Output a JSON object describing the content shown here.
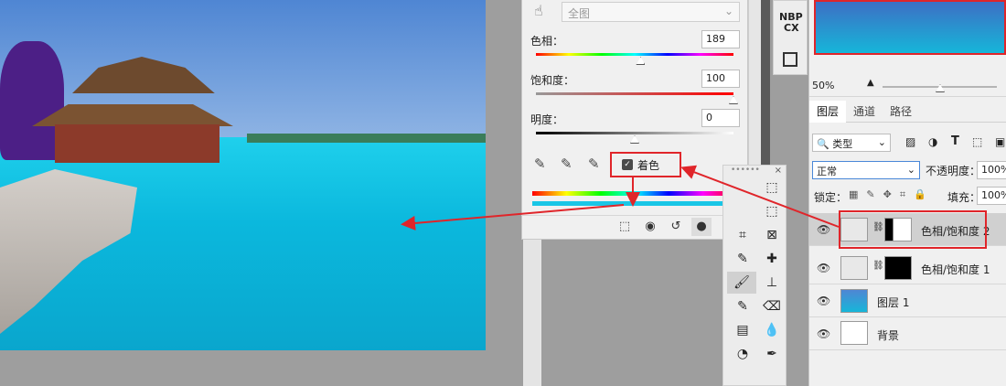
{
  "canvas": {
    "description_colors": {
      "sky": "#4f86d3",
      "water": "#1fd0ec"
    }
  },
  "properties": {
    "preset_value": "全图",
    "hue_label": "色相：",
    "hue_value": "189",
    "saturation_label": "饱和度：",
    "saturation_value": "100",
    "lightness_label": "明度：",
    "lightness_value": "0",
    "colorize_label": "着色",
    "colorize_checked": true,
    "hue_level": 0.53,
    "saturation_level": 1.0,
    "lightness_level": 0.5
  },
  "icon_strip": {
    "item1": "NBP",
    "item2": "CX"
  },
  "navigator": {
    "zoom": "50%"
  },
  "layers_panel": {
    "tabs": [
      "图层",
      "通道",
      "路径"
    ],
    "filter_label": "类型",
    "blend_mode": "正常",
    "opacity_label": "不透明度：",
    "opacity_value": "100%",
    "lock_label": "锁定：",
    "fill_label": "填充：",
    "fill_value": "100%",
    "layers": [
      {
        "name": "色相/饱和度 2",
        "type": "adjustment",
        "selected": true
      },
      {
        "name": "色相/饱和度 1",
        "type": "adjustment",
        "selected": false
      },
      {
        "name": "图层 1",
        "type": "image",
        "selected": false
      },
      {
        "name": "背景",
        "type": "background",
        "selected": false
      }
    ]
  },
  "accent": {
    "annotation_red": "#e0252a",
    "selection": "#d0d0d0"
  }
}
